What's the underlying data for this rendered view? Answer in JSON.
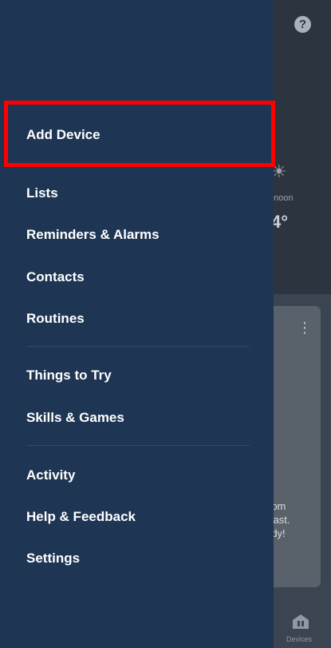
{
  "background": {
    "help_glyph": "?",
    "weather_sun": "☀",
    "weather_label": "noon",
    "weather_temp": "4°",
    "card_menu_glyph": "⋮",
    "card_text_lines": [
      "rom",
      "cast.",
      "rdy!"
    ],
    "bottom_nav": {
      "devices_label": "Devices",
      "devices_icon": "devices-home-icon"
    },
    "colors": {
      "dim_bg": "#3b4451",
      "card": "#59616b"
    }
  },
  "drawer": {
    "bg_color": "#1e3553",
    "items": [
      {
        "label": "Add Device"
      },
      {
        "label": "Lists"
      },
      {
        "label": "Reminders & Alarms"
      },
      {
        "label": "Contacts"
      },
      {
        "label": "Routines"
      },
      {
        "label": "Things to Try"
      },
      {
        "label": "Skills & Games"
      },
      {
        "label": "Activity"
      },
      {
        "label": "Help & Feedback"
      },
      {
        "label": "Settings"
      }
    ]
  },
  "highlight": {
    "color": "#ff0000",
    "target": "Add Device"
  }
}
